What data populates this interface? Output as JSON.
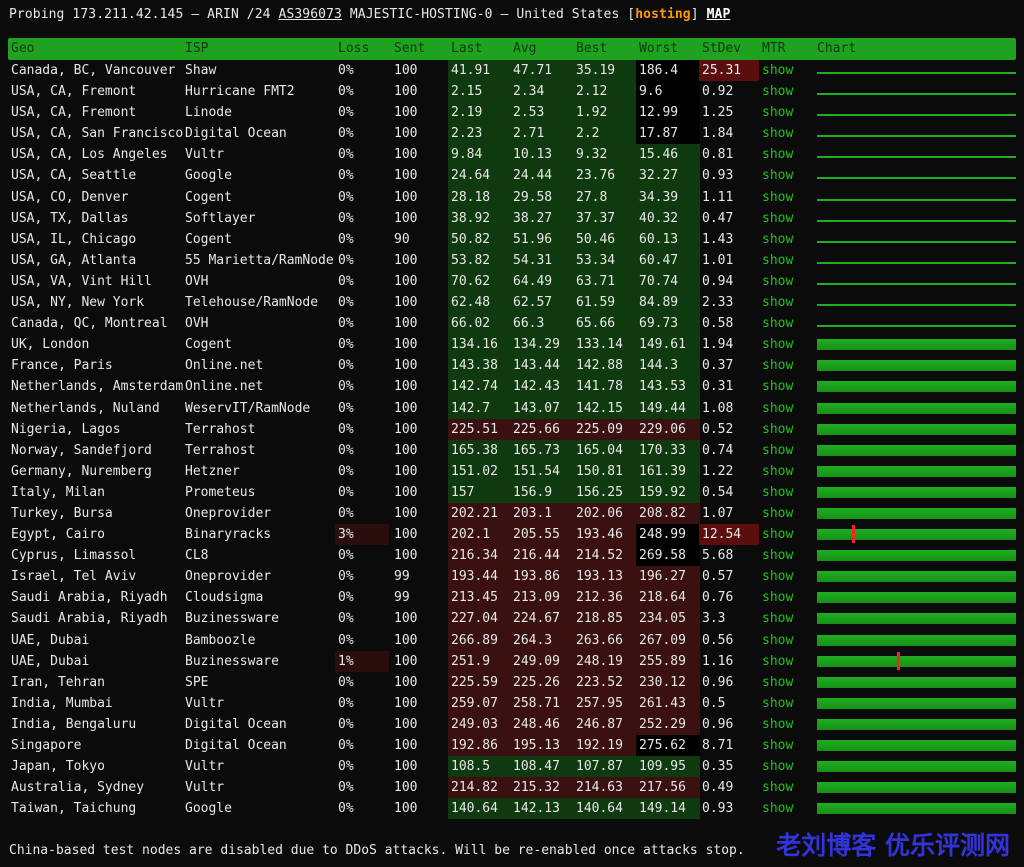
{
  "header": {
    "prefix": "Probing 173.211.42.145 — ARIN /24 ",
    "asn": "AS396073",
    "org": " MAJESTIC-HOSTING-0 — United States [",
    "tag": "hosting",
    "close": "] ",
    "map": "MAP"
  },
  "columns": [
    "Geo",
    "ISP",
    "Loss",
    "Sent",
    "Last",
    "Avg",
    "Best",
    "Worst",
    "StDev",
    "MTR",
    "Chart"
  ],
  "rows": [
    {
      "geo": "Canada, BC, Vancouver",
      "isp": "Shaw",
      "loss": "0%",
      "sent": "100",
      "last": "41.91",
      "avg": "47.71",
      "best": "35.19",
      "worst": "186.4",
      "stdev": "25.31",
      "mtr": "show"
    },
    {
      "geo": "USA, CA, Fremont",
      "isp": "Hurricane FMT2",
      "loss": "0%",
      "sent": "100",
      "last": "2.15",
      "avg": "2.34",
      "best": "2.12",
      "worst": "9.6",
      "stdev": "0.92",
      "mtr": "show"
    },
    {
      "geo": "USA, CA, Fremont",
      "isp": "Linode",
      "loss": "0%",
      "sent": "100",
      "last": "2.19",
      "avg": "2.53",
      "best": "1.92",
      "worst": "12.99",
      "stdev": "1.25",
      "mtr": "show"
    },
    {
      "geo": "USA, CA, San Francisco",
      "isp": "Digital Ocean",
      "loss": "0%",
      "sent": "100",
      "last": "2.23",
      "avg": "2.71",
      "best": "2.2",
      "worst": "17.87",
      "stdev": "1.84",
      "mtr": "show"
    },
    {
      "geo": "USA, CA, Los Angeles",
      "isp": "Vultr",
      "loss": "0%",
      "sent": "100",
      "last": "9.84",
      "avg": "10.13",
      "best": "9.32",
      "worst": "15.46",
      "stdev": "0.81",
      "mtr": "show"
    },
    {
      "geo": "USA, CA, Seattle",
      "isp": "Google",
      "loss": "0%",
      "sent": "100",
      "last": "24.64",
      "avg": "24.44",
      "best": "23.76",
      "worst": "32.27",
      "stdev": "0.93",
      "mtr": "show"
    },
    {
      "geo": "USA, CO, Denver",
      "isp": "Cogent",
      "loss": "0%",
      "sent": "100",
      "last": "28.18",
      "avg": "29.58",
      "best": "27.8",
      "worst": "34.39",
      "stdev": "1.11",
      "mtr": "show"
    },
    {
      "geo": "USA, TX, Dallas",
      "isp": "Softlayer",
      "loss": "0%",
      "sent": "100",
      "last": "38.92",
      "avg": "38.27",
      "best": "37.37",
      "worst": "40.32",
      "stdev": "0.47",
      "mtr": "show"
    },
    {
      "geo": "USA, IL, Chicago",
      "isp": "Cogent",
      "loss": "0%",
      "sent": "90",
      "last": "50.82",
      "avg": "51.96",
      "best": "50.46",
      "worst": "60.13",
      "stdev": "1.43",
      "mtr": "show"
    },
    {
      "geo": "USA, GA, Atlanta",
      "isp": "55 Marietta/RamNode",
      "loss": "0%",
      "sent": "100",
      "last": "53.82",
      "avg": "54.31",
      "best": "53.34",
      "worst": "60.47",
      "stdev": "1.01",
      "mtr": "show"
    },
    {
      "geo": "USA, VA, Vint Hill",
      "isp": "OVH",
      "loss": "0%",
      "sent": "100",
      "last": "70.62",
      "avg": "64.49",
      "best": "63.71",
      "worst": "70.74",
      "stdev": "0.94",
      "mtr": "show"
    },
    {
      "geo": "USA, NY, New York",
      "isp": "Telehouse/RamNode",
      "loss": "0%",
      "sent": "100",
      "last": "62.48",
      "avg": "62.57",
      "best": "61.59",
      "worst": "84.89",
      "stdev": "2.33",
      "mtr": "show"
    },
    {
      "geo": "Canada, QC, Montreal",
      "isp": "OVH",
      "loss": "0%",
      "sent": "100",
      "last": "66.02",
      "avg": "66.3",
      "best": "65.66",
      "worst": "69.73",
      "stdev": "0.58",
      "mtr": "show"
    },
    {
      "geo": "UK, London",
      "isp": "Cogent",
      "loss": "0%",
      "sent": "100",
      "last": "134.16",
      "avg": "134.29",
      "best": "133.14",
      "worst": "149.61",
      "stdev": "1.94",
      "mtr": "show"
    },
    {
      "geo": "France, Paris",
      "isp": "Online.net",
      "loss": "0%",
      "sent": "100",
      "last": "143.38",
      "avg": "143.44",
      "best": "142.88",
      "worst": "144.3",
      "stdev": "0.37",
      "mtr": "show"
    },
    {
      "geo": "Netherlands, Amsterdam",
      "isp": "Online.net",
      "loss": "0%",
      "sent": "100",
      "last": "142.74",
      "avg": "142.43",
      "best": "141.78",
      "worst": "143.53",
      "stdev": "0.31",
      "mtr": "show"
    },
    {
      "geo": "Netherlands, Nuland",
      "isp": "WeservIT/RamNode",
      "loss": "0%",
      "sent": "100",
      "last": "142.7",
      "avg": "143.07",
      "best": "142.15",
      "worst": "149.44",
      "stdev": "1.08",
      "mtr": "show"
    },
    {
      "geo": "Nigeria, Lagos",
      "isp": "Terrahost",
      "loss": "0%",
      "sent": "100",
      "last": "225.51",
      "avg": "225.66",
      "best": "225.09",
      "worst": "229.06",
      "stdev": "0.52",
      "mtr": "show"
    },
    {
      "geo": "Norway, Sandefjord",
      "isp": "Terrahost",
      "loss": "0%",
      "sent": "100",
      "last": "165.38",
      "avg": "165.73",
      "best": "165.04",
      "worst": "170.33",
      "stdev": "0.74",
      "mtr": "show"
    },
    {
      "geo": "Germany, Nuremberg",
      "isp": "Hetzner",
      "loss": "0%",
      "sent": "100",
      "last": "151.02",
      "avg": "151.54",
      "best": "150.81",
      "worst": "161.39",
      "stdev": "1.22",
      "mtr": "show"
    },
    {
      "geo": "Italy, Milan",
      "isp": "Prometeus",
      "loss": "0%",
      "sent": "100",
      "last": "157",
      "avg": "156.9",
      "best": "156.25",
      "worst": "159.92",
      "stdev": "0.54",
      "mtr": "show"
    },
    {
      "geo": "Turkey, Bursa",
      "isp": "Oneprovider",
      "loss": "0%",
      "sent": "100",
      "last": "202.21",
      "avg": "203.1",
      "best": "202.06",
      "worst": "208.82",
      "stdev": "1.07",
      "mtr": "show"
    },
    {
      "geo": "Egypt, Cairo",
      "isp": "Binaryracks",
      "loss": "3%",
      "sent": "100",
      "last": "202.1",
      "avg": "205.55",
      "best": "193.46",
      "worst": "248.99",
      "stdev": "12.54",
      "mtr": "show"
    },
    {
      "geo": "Cyprus, Limassol",
      "isp": "CL8",
      "loss": "0%",
      "sent": "100",
      "last": "216.34",
      "avg": "216.44",
      "best": "214.52",
      "worst": "269.58",
      "stdev": "5.68",
      "mtr": "show"
    },
    {
      "geo": "Israel, Tel Aviv",
      "isp": "Oneprovider",
      "loss": "0%",
      "sent": "99",
      "last": "193.44",
      "avg": "193.86",
      "best": "193.13",
      "worst": "196.27",
      "stdev": "0.57",
      "mtr": "show"
    },
    {
      "geo": "Saudi Arabia, Riyadh",
      "isp": "Cloudsigma",
      "loss": "0%",
      "sent": "99",
      "last": "213.45",
      "avg": "213.09",
      "best": "212.36",
      "worst": "218.64",
      "stdev": "0.76",
      "mtr": "show"
    },
    {
      "geo": "Saudi Arabia, Riyadh",
      "isp": "Buzinessware",
      "loss": "0%",
      "sent": "100",
      "last": "227.04",
      "avg": "224.67",
      "best": "218.85",
      "worst": "234.05",
      "stdev": "3.3",
      "mtr": "show"
    },
    {
      "geo": "UAE, Dubai",
      "isp": "Bamboozle",
      "loss": "0%",
      "sent": "100",
      "last": "266.89",
      "avg": "264.3",
      "best": "263.66",
      "worst": "267.09",
      "stdev": "0.56",
      "mtr": "show"
    },
    {
      "geo": "UAE, Dubai",
      "isp": "Buzinessware",
      "loss": "1%",
      "sent": "100",
      "last": "251.9",
      "avg": "249.09",
      "best": "248.19",
      "worst": "255.89",
      "stdev": "1.16",
      "mtr": "show"
    },
    {
      "geo": "Iran, Tehran",
      "isp": "SPE",
      "loss": "0%",
      "sent": "100",
      "last": "225.59",
      "avg": "225.26",
      "best": "223.52",
      "worst": "230.12",
      "stdev": "0.96",
      "mtr": "show"
    },
    {
      "geo": "India, Mumbai",
      "isp": "Vultr",
      "loss": "0%",
      "sent": "100",
      "last": "259.07",
      "avg": "258.71",
      "best": "257.95",
      "worst": "261.43",
      "stdev": "0.5",
      "mtr": "show"
    },
    {
      "geo": "India, Bengaluru",
      "isp": "Digital Ocean",
      "loss": "0%",
      "sent": "100",
      "last": "249.03",
      "avg": "248.46",
      "best": "246.87",
      "worst": "252.29",
      "stdev": "0.96",
      "mtr": "show"
    },
    {
      "geo": "Singapore",
      "isp": "Digital Ocean",
      "loss": "0%",
      "sent": "100",
      "last": "192.86",
      "avg": "195.13",
      "best": "192.19",
      "worst": "275.62",
      "stdev": "8.71",
      "mtr": "show"
    },
    {
      "geo": "Japan, Tokyo",
      "isp": "Vultr",
      "loss": "0%",
      "sent": "100",
      "last": "108.5",
      "avg": "108.47",
      "best": "107.87",
      "worst": "109.95",
      "stdev": "0.35",
      "mtr": "show"
    },
    {
      "geo": "Australia, Sydney",
      "isp": "Vultr",
      "loss": "0%",
      "sent": "100",
      "last": "214.82",
      "avg": "215.32",
      "best": "214.63",
      "worst": "217.56",
      "stdev": "0.49",
      "mtr": "show"
    },
    {
      "geo": "Taiwan, Taichung",
      "isp": "Google",
      "loss": "0%",
      "sent": "100",
      "last": "140.64",
      "avg": "142.13",
      "best": "140.64",
      "worst": "149.14",
      "stdev": "0.93",
      "mtr": "show"
    }
  ],
  "footer": "China-based test nodes are disabled due to DDoS attacks. Will be re-enabled once attacks stop.",
  "watermark": "老刘博客 优乐评测网",
  "colors": {
    "header_bar": "#1fa21f",
    "mtr_link": "#1fc41f",
    "hosting_tag": "#ff9900",
    "loss_spike": "#ff2020",
    "bar_green": "#1fae1f"
  }
}
